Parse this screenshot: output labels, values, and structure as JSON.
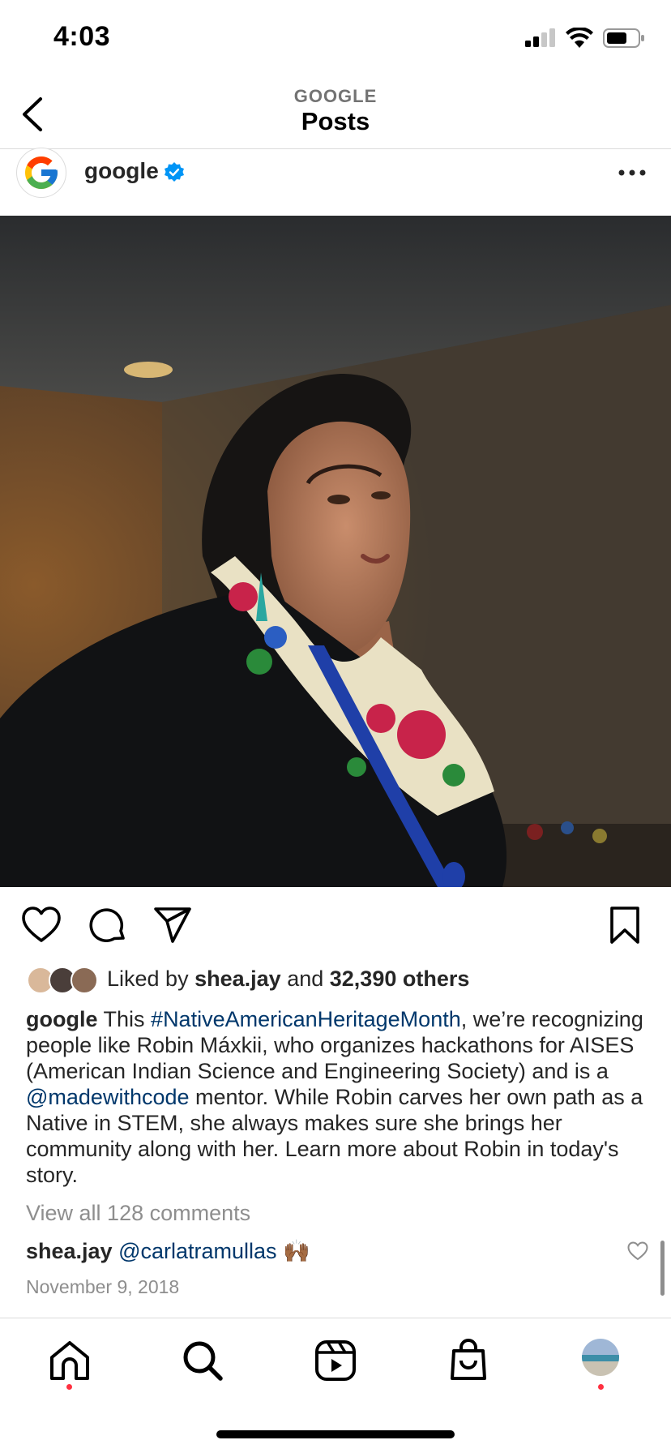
{
  "status_bar": {
    "time": "4:03"
  },
  "header": {
    "subtitle": "GOOGLE",
    "title": "Posts"
  },
  "post": {
    "username": "google",
    "verified": true,
    "liked_by_user": "shea.jay",
    "liked_by_joiner": "and",
    "liked_by_prefix": "Liked by",
    "liked_others": "32,390 others",
    "caption": {
      "author": "google",
      "text_1": "This",
      "hashtag": "#NativeAmericanHeritageMonth",
      "text_2": ", we’re recognizing people like Robin Máxkii, who organizes hackathons for AISES (American Indian Science and Engineering Society) and is a",
      "mention": "@madewithcode",
      "text_3": "mentor. While Robin carves her own path as a Native in STEM, she always makes sure she brings her community along with her. Learn more about Robin in today's story."
    },
    "view_comments": "View all 128 comments",
    "comment": {
      "user": "shea.jay",
      "mention": "@carlatramullas",
      "emoji": "🙌🏾"
    },
    "date": "November 9, 2018"
  },
  "colors": {
    "link": "#00376b",
    "notification_dot": "#ff3040",
    "muted": "#8e8e8e"
  },
  "icons": {
    "actions": [
      "heart-icon",
      "comment-icon",
      "share-icon",
      "bookmark-icon"
    ],
    "nav": [
      "home-icon",
      "search-icon",
      "reels-icon",
      "shop-icon",
      "profile-avatar"
    ]
  }
}
